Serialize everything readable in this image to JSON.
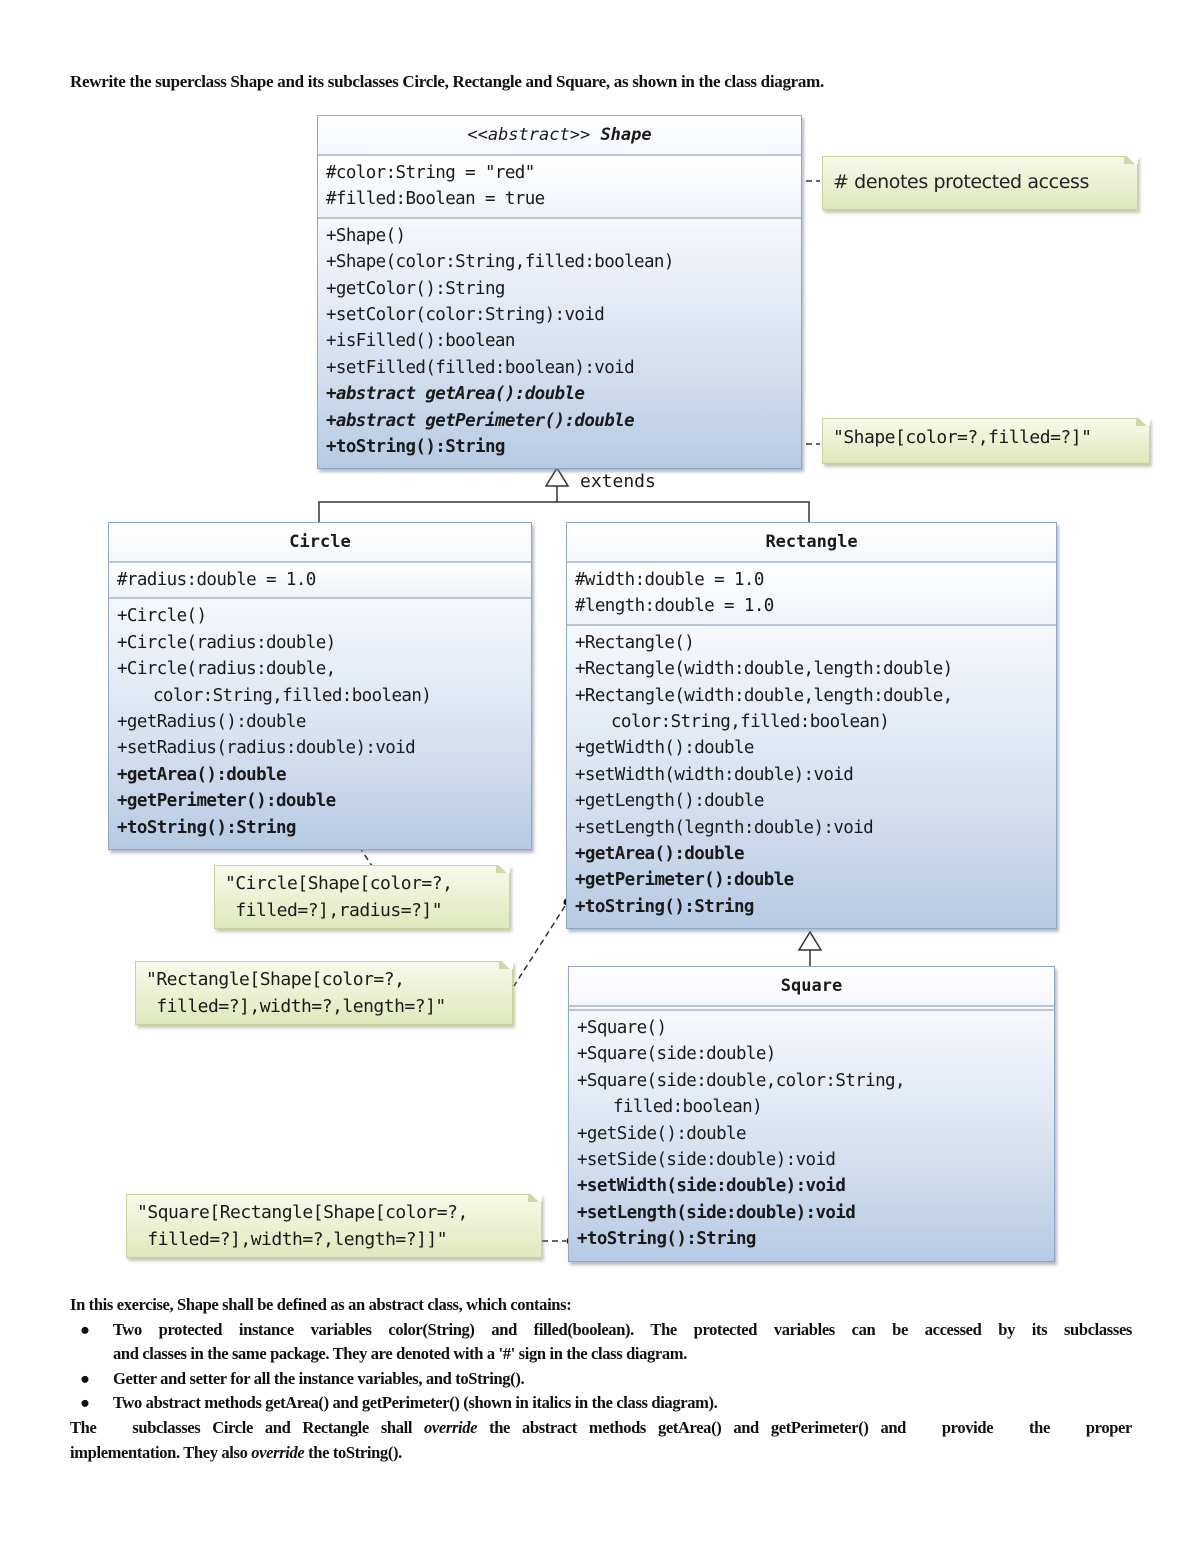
{
  "intro": "Rewrite the superclass Shape and its subclasses Circle, Rectangle and Square, as shown in the class diagram.",
  "diagram": {
    "shape": {
      "stereotype": "<<abstract>>",
      "name": "Shape",
      "attributes": [
        "#color:String = \"red\"",
        "#filled:Boolean = true"
      ],
      "operations": [
        {
          "text": "+Shape()",
          "style": "normal"
        },
        {
          "text": "+Shape(color:String,filled:boolean)",
          "style": "normal"
        },
        {
          "text": "+getColor():String",
          "style": "normal"
        },
        {
          "text": "+setColor(color:String):void",
          "style": "normal"
        },
        {
          "text": "+isFilled():boolean",
          "style": "normal"
        },
        {
          "text": "+setFilled(filled:boolean):void",
          "style": "normal"
        },
        {
          "text": "+abstract getArea():double",
          "style": "bold-italic"
        },
        {
          "text": "+abstract getPerimeter():double",
          "style": "bold-italic"
        },
        {
          "text": "+toString():String",
          "style": "bold"
        }
      ]
    },
    "circle": {
      "name": "Circle",
      "attributes": [
        "#radius:double = 1.0"
      ],
      "operations": [
        {
          "text": "+Circle()",
          "style": "normal"
        },
        {
          "text": "+Circle(radius:double)",
          "style": "normal"
        },
        {
          "text": "+Circle(radius:double,",
          "style": "normal"
        },
        {
          "text": "color:String,filled:boolean)",
          "style": "indent"
        },
        {
          "text": "+getRadius():double",
          "style": "normal"
        },
        {
          "text": "+setRadius(radius:double):void",
          "style": "normal"
        },
        {
          "text": "+getArea():double",
          "style": "bold"
        },
        {
          "text": "+getPerimeter():double",
          "style": "bold"
        },
        {
          "text": "+toString():String",
          "style": "bold"
        }
      ]
    },
    "rectangle": {
      "name": "Rectangle",
      "attributes": [
        "#width:double = 1.0",
        "#length:double = 1.0"
      ],
      "operations": [
        {
          "text": "+Rectangle()",
          "style": "normal"
        },
        {
          "text": "+Rectangle(width:double,length:double)",
          "style": "normal"
        },
        {
          "text": "+Rectangle(width:double,length:double,",
          "style": "normal"
        },
        {
          "text": "color:String,filled:boolean)",
          "style": "indent"
        },
        {
          "text": "+getWidth():double",
          "style": "normal"
        },
        {
          "text": "+setWidth(width:double):void",
          "style": "normal"
        },
        {
          "text": "+getLength():double",
          "style": "normal"
        },
        {
          "text": "+setLength(legnth:double):void",
          "style": "normal"
        },
        {
          "text": "+getArea():double",
          "style": "bold"
        },
        {
          "text": "+getPerimeter():double",
          "style": "bold"
        },
        {
          "text": "+toString():String",
          "style": "bold"
        }
      ]
    },
    "square": {
      "name": "Square",
      "attributes": [],
      "operations": [
        {
          "text": "+Square()",
          "style": "normal"
        },
        {
          "text": "+Square(side:double)",
          "style": "normal"
        },
        {
          "text": "+Square(side:double,color:String,",
          "style": "normal"
        },
        {
          "text": "filled:boolean)",
          "style": "indent"
        },
        {
          "text": "+getSide():double",
          "style": "normal"
        },
        {
          "text": "+setSide(side:double):void",
          "style": "normal"
        },
        {
          "text": "+setWidth(side:double):void",
          "style": "bold"
        },
        {
          "text": "+setLength(side:double):void",
          "style": "bold"
        },
        {
          "text": "+toString():String",
          "style": "bold"
        }
      ]
    },
    "extends_label": "extends",
    "notes": {
      "protected": "# denotes protected access",
      "shape_tostring": "\"Shape[color=?,filled=?]\"",
      "circle_tostring": [
        "\"Circle[Shape[color=?,",
        " filled=?],radius=?]\""
      ],
      "rectangle_tostring": [
        "\"Rectangle[Shape[color=?,",
        " filled=?],width=?,length=?]\""
      ],
      "square_tostring": [
        "\"Square[Rectangle[Shape[color=?,",
        " filled=?],width=?,length=?]]\""
      ]
    }
  },
  "body": {
    "lead": "In this exercise, Shape shall be defined as an abstract class, which contains:",
    "bullet_glyph": "●",
    "bullets": [
      [
        "Two protected instance variables color(String) and filled(boolean). The protected variables can be accessed by its subclasses",
        "and classes in the same package. They are denoted with a '#' sign in the class diagram."
      ],
      [
        "Getter and setter for all the instance variables, and toString()."
      ],
      [
        "Two abstract methods getArea() and getPerimeter() (shown in italics in the class diagram)."
      ]
    ],
    "closing": {
      "part1": "The   subclasses Circle and Rectangle shall ",
      "em1": "override",
      "part2": " the abstract methods getArea() and getPerimeter() and   provide   the   proper",
      "line2a": "implementation. They also ",
      "em2": "override",
      "line2b": " the toString()."
    }
  }
}
